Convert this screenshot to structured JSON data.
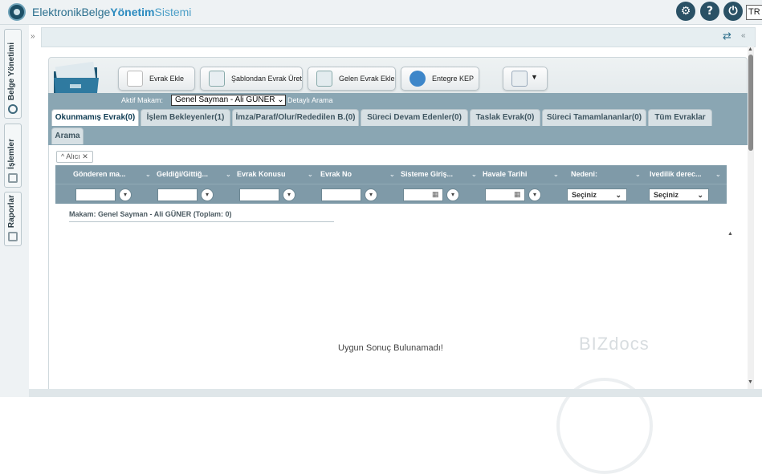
{
  "app": {
    "title_part1": "Elektronik",
    "title_part2": "Belge",
    "title_part3": "Yönetim",
    "title_part4": "Sistemi",
    "language": "TR"
  },
  "top_icons": [
    "settings-icon",
    "help-icon",
    "power-icon"
  ],
  "sidebar": {
    "items": [
      {
        "label": "Belge Yönetimi",
        "icon": "circle-icon"
      },
      {
        "label": "İşlemler",
        "icon": "wrench-icon"
      },
      {
        "label": "Raporlar",
        "icon": "report-icon"
      }
    ]
  },
  "toolbar": {
    "buttons": [
      {
        "label": "Evrak Ekle",
        "icon": "document-add-icon"
      },
      {
        "label": "Şablondan Evrak Üret",
        "icon": "template-icon"
      },
      {
        "label": "Gelen Evrak Ekle",
        "icon": "incoming-document-icon"
      },
      {
        "label": "Entegre KEP",
        "icon": "kep-icon"
      },
      {
        "label": "",
        "icon": "more-dropdown-icon"
      }
    ]
  },
  "makam": {
    "label": "Aktif Makam:",
    "selected": "Genel Sayman - Ali GÜNER",
    "detail_link": "Detaylı Arama"
  },
  "tabs": [
    {
      "label": "Okunmamış Evrak(0)",
      "active": true
    },
    {
      "label": "İşlem Bekleyenler(1)",
      "active": false
    },
    {
      "label": "İmza/Paraf/Olur/Rededilen B.(0)",
      "active": false
    },
    {
      "label": "Süreci Devam Edenler(0)",
      "active": false
    },
    {
      "label": "Taslak Evrak(0)",
      "active": false
    },
    {
      "label": "Süreci Tamamlananlar(0)",
      "active": false
    },
    {
      "label": "Tüm Evraklar",
      "active": false
    },
    {
      "label": "Arama",
      "active": false
    }
  ],
  "grid": {
    "filter_chip": "Alıcı",
    "columns": [
      "Gönderen ma...",
      "Geldiği/Gittiğ...",
      "Evrak Konusu",
      "Evrak No",
      "Sisteme Giriş...",
      "Havale Tarihi",
      "Nedeni:",
      "Ivedilik derec..."
    ],
    "select_placeholder": "Seçiniz",
    "group_row": "Makam: Genel Sayman - Ali GÜNER (Toplam: 0)",
    "empty_message": "Uygun Sonuç Bulunamadı!",
    "watermark": "BIZdocs"
  }
}
